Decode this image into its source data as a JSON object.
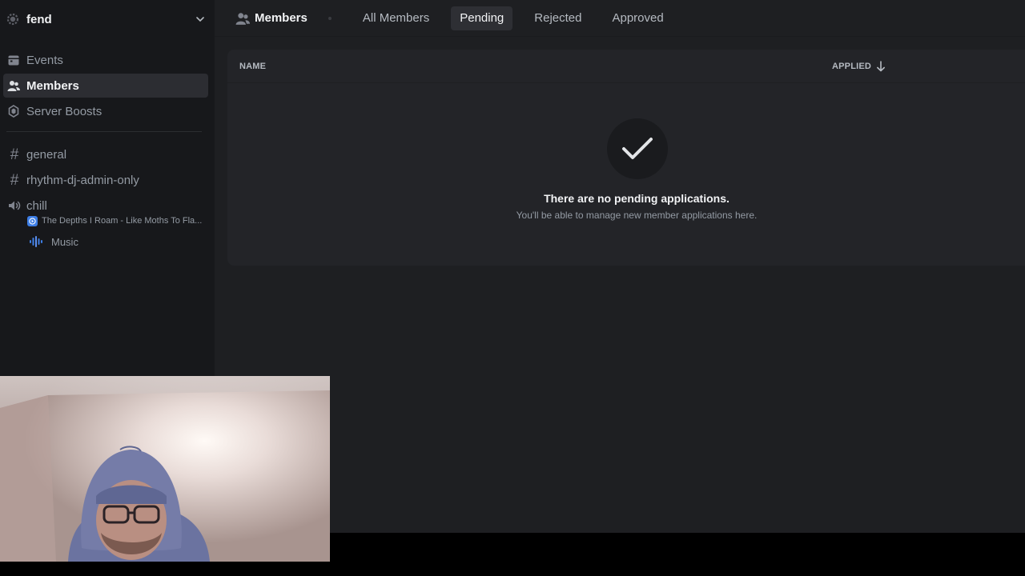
{
  "server": {
    "name": "fend"
  },
  "sidebar": {
    "items": [
      {
        "label": "Events",
        "icon": "calendar-icon"
      },
      {
        "label": "Members",
        "icon": "members-icon",
        "active": true
      },
      {
        "label": "Server Boosts",
        "icon": "boost-icon"
      }
    ],
    "channels": [
      {
        "label": "general",
        "type": "text"
      },
      {
        "label": "rhythm-dj-admin-only",
        "type": "text"
      },
      {
        "label": "chill",
        "type": "voice"
      }
    ],
    "voice_activity": "The Depths I Roam - Like Moths To Fla...",
    "voice_user": "Music"
  },
  "topbar": {
    "title": "Members",
    "tabs": [
      {
        "label": "All Members"
      },
      {
        "label": "Pending",
        "active": true
      },
      {
        "label": "Rejected"
      },
      {
        "label": "Approved"
      }
    ]
  },
  "table": {
    "col_name": "NAME",
    "col_applied": "APPLIED"
  },
  "empty_state": {
    "title": "There are no pending applications.",
    "subtitle": "You'll be able to manage new member applications here."
  },
  "colors": {
    "accent": "#3d7ee6",
    "background": "#1e1f22",
    "sidebar": "#17181b"
  }
}
